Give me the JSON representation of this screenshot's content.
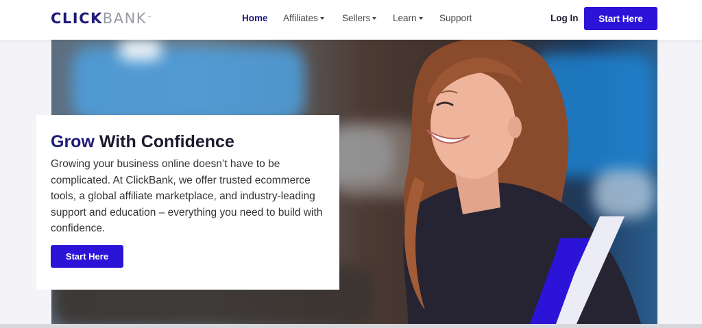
{
  "brand": {
    "logo_primary": "CLICK",
    "logo_secondary": "BANK",
    "logo_mark": "™",
    "color": "#1f1a7a"
  },
  "nav": {
    "items": [
      {
        "label": "Home",
        "active": true
      },
      {
        "label": "Affiliates",
        "dropdown": true
      },
      {
        "label": "Sellers",
        "dropdown": true
      },
      {
        "label": "Learn",
        "dropdown": true
      },
      {
        "label": "Support"
      }
    ],
    "login_label": "Log In",
    "cta_label": "Start Here"
  },
  "hero": {
    "title_bold": "Grow",
    "title_rest": "With Confidence",
    "body": "Growing your business online doesn’t have to be complicated. At ClickBank, we offer trusted ecommerce tools, a global affiliate marketplace, and industry-leading support and education – everything you need to build with confidence.",
    "cta_label": "Start Here",
    "image_icon": "smiling-woman-photo"
  },
  "colors": {
    "accent": "#2b14d8",
    "navy": "#1f1a7a",
    "stripe_light": "#e9e9f4"
  }
}
